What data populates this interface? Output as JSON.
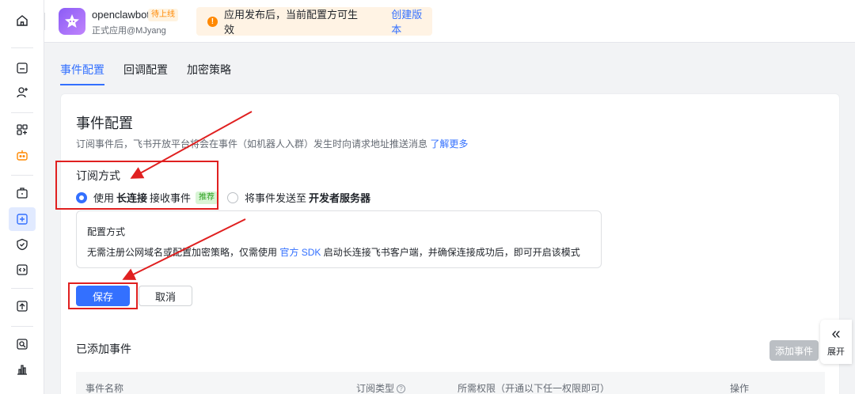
{
  "header": {
    "app_name": "openclawbot",
    "status_badge": "待上线",
    "app_subtitle": "正式应用@MJyang",
    "notice_text": "应用发布后，当前配置方可生效",
    "notice_link": "创建版本"
  },
  "tabs": [
    {
      "label": "事件配置",
      "active": true
    },
    {
      "label": "回调配置",
      "active": false
    },
    {
      "label": "加密策略",
      "active": false
    }
  ],
  "section": {
    "title": "事件配置",
    "description": "订阅事件后，飞书开放平台将会在事件（如机器人入群）发生时向请求地址推送消息",
    "learn_more": "了解更多",
    "subscription_title": "订阅方式"
  },
  "options": {
    "long_conn_prefix": "使用",
    "long_conn_bold": "长连接",
    "long_conn_suffix": "接收事件",
    "recommended": "推荐",
    "server_prefix": "将事件发送至",
    "server_bold": "开发者服务器"
  },
  "config_box": {
    "title": "配置方式",
    "text_before": "无需注册公网域名或配置加密策略，仅需使用",
    "sdk_link": "官方 SDK",
    "text_after": "启动长连接飞书客户端，并确保连接成功后，即可开启该模式"
  },
  "buttons": {
    "save": "保存",
    "cancel": "取消",
    "add_event": "添加事件"
  },
  "events": {
    "title": "已添加事件",
    "columns": [
      "事件名称",
      "订阅类型",
      "所需权限（开通以下任一权限即可）",
      "操作"
    ]
  },
  "expand": {
    "label": "展开"
  },
  "colors": {
    "primary": "#3370ff",
    "annotation": "#e02020",
    "warning": "#ff8800"
  }
}
